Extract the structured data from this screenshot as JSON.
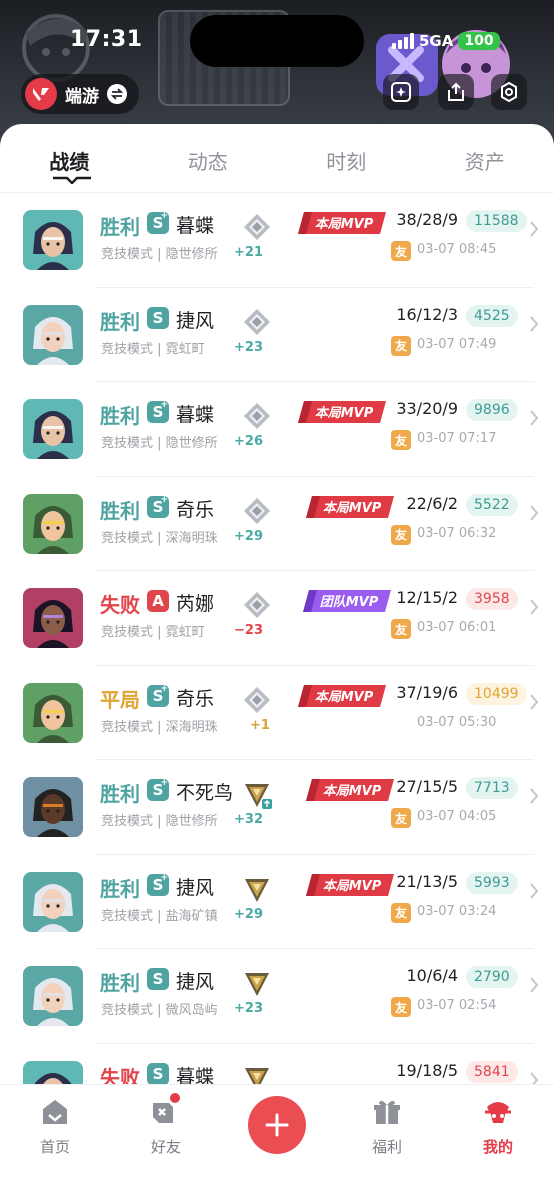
{
  "status_bar": {
    "time": "17:31",
    "network": "5GA",
    "battery": "100"
  },
  "header": {
    "brand_name": "端游",
    "buttons": [
      "spark-icon",
      "share-icon",
      "settings-icon"
    ]
  },
  "tabs": [
    {
      "label": "战绩",
      "active": true
    },
    {
      "label": "动态",
      "active": false
    },
    {
      "label": "时刻",
      "active": false
    },
    {
      "label": "资产",
      "active": false
    }
  ],
  "matches": [
    {
      "result": "胜利",
      "outcome": "win",
      "grade": "S",
      "grade_plus": true,
      "agent": "暮蝶",
      "mode": "竞技模式",
      "map": "隐世修所",
      "rank_icon": "silver",
      "rr": "+21",
      "badge": "本局MVP",
      "badge_type": "match",
      "kda": "38/28/9",
      "score": "11588",
      "friend": "友",
      "time": "03-07 08:45",
      "avatar": "clove"
    },
    {
      "result": "胜利",
      "outcome": "win",
      "grade": "S",
      "grade_plus": false,
      "agent": "捷风",
      "mode": "竞技模式",
      "map": "霓虹町",
      "rank_icon": "silver",
      "rr": "+23",
      "badge": "",
      "badge_type": "",
      "kda": "16/12/3",
      "score": "4525",
      "friend": "友",
      "time": "03-07 07:49",
      "avatar": "jett"
    },
    {
      "result": "胜利",
      "outcome": "win",
      "grade": "S",
      "grade_plus": true,
      "agent": "暮蝶",
      "mode": "竞技模式",
      "map": "隐世修所",
      "rank_icon": "silver",
      "rr": "+26",
      "badge": "本局MVP",
      "badge_type": "match",
      "kda": "33/20/9",
      "score": "9896",
      "friend": "友",
      "time": "03-07 07:17",
      "avatar": "clove"
    },
    {
      "result": "胜利",
      "outcome": "win",
      "grade": "S",
      "grade_plus": true,
      "agent": "奇乐",
      "mode": "竞技模式",
      "map": "深海明珠",
      "rank_icon": "silver",
      "rr": "+29",
      "badge": "本局MVP",
      "badge_type": "match",
      "kda": "22/6/2",
      "score": "5522",
      "friend": "友",
      "time": "03-07 06:32",
      "avatar": "killjoy"
    },
    {
      "result": "失败",
      "outcome": "lose",
      "grade": "A",
      "grade_plus": false,
      "agent": "芮娜",
      "mode": "竞技模式",
      "map": "霓虹町",
      "rank_icon": "silver",
      "rr": "−23",
      "badge": "团队MVP",
      "badge_type": "team",
      "kda": "12/15/2",
      "score": "3958",
      "friend": "友",
      "time": "03-07 06:01",
      "avatar": "reyna"
    },
    {
      "result": "平局",
      "outcome": "draw",
      "grade": "S",
      "grade_plus": true,
      "agent": "奇乐",
      "mode": "竞技模式",
      "map": "深海明珠",
      "rank_icon": "silver",
      "rr": "+1",
      "badge": "本局MVP",
      "badge_type": "match",
      "kda": "37/19/6",
      "score": "10499",
      "friend": "",
      "time": "03-07 05:30",
      "avatar": "killjoy"
    },
    {
      "result": "胜利",
      "outcome": "win",
      "grade": "S",
      "grade_plus": true,
      "agent": "不死鸟",
      "mode": "竞技模式",
      "map": "隐世修所",
      "rank_icon": "gold-up",
      "rr": "+32",
      "badge": "本局MVP",
      "badge_type": "match",
      "kda": "27/15/5",
      "score": "7713",
      "friend": "友",
      "time": "03-07 04:05",
      "avatar": "phoenix"
    },
    {
      "result": "胜利",
      "outcome": "win",
      "grade": "S",
      "grade_plus": true,
      "agent": "捷风",
      "mode": "竞技模式",
      "map": "盐海矿镇",
      "rank_icon": "gold",
      "rr": "+29",
      "badge": "本局MVP",
      "badge_type": "match",
      "kda": "21/13/5",
      "score": "5993",
      "friend": "友",
      "time": "03-07 03:24",
      "avatar": "jett"
    },
    {
      "result": "胜利",
      "outcome": "win",
      "grade": "S",
      "grade_plus": false,
      "agent": "捷风",
      "mode": "竞技模式",
      "map": "微风岛屿",
      "rank_icon": "gold",
      "rr": "+23",
      "badge": "",
      "badge_type": "",
      "kda": "10/6/4",
      "score": "2790",
      "friend": "友",
      "time": "03-07 02:54",
      "avatar": "jett"
    },
    {
      "result": "失败",
      "outcome": "lose",
      "grade": "S",
      "grade_plus": false,
      "agent": "暮蝶",
      "mode": "",
      "map": "",
      "rank_icon": "gold",
      "rr": "",
      "badge": "",
      "badge_type": "",
      "kda": "19/18/5",
      "score": "5841",
      "friend": "",
      "time": "",
      "avatar": "clove"
    }
  ],
  "bottom_nav": [
    {
      "label": "首页",
      "icon": "home-icon",
      "active": false
    },
    {
      "label": "好友",
      "icon": "friends-icon",
      "active": false,
      "dot": true
    },
    {
      "label": "",
      "icon": "plus-icon",
      "active": false
    },
    {
      "label": "福利",
      "icon": "gift-icon",
      "active": false
    },
    {
      "label": "我的",
      "icon": "profile-icon",
      "active": true
    }
  ],
  "colors": {
    "win": "#4fa4a2",
    "lose": "#e1454c",
    "draw": "#e2a436",
    "accent": "#e53a48",
    "mvp": "#d8323e",
    "team_mvp": "#8b4de0"
  }
}
